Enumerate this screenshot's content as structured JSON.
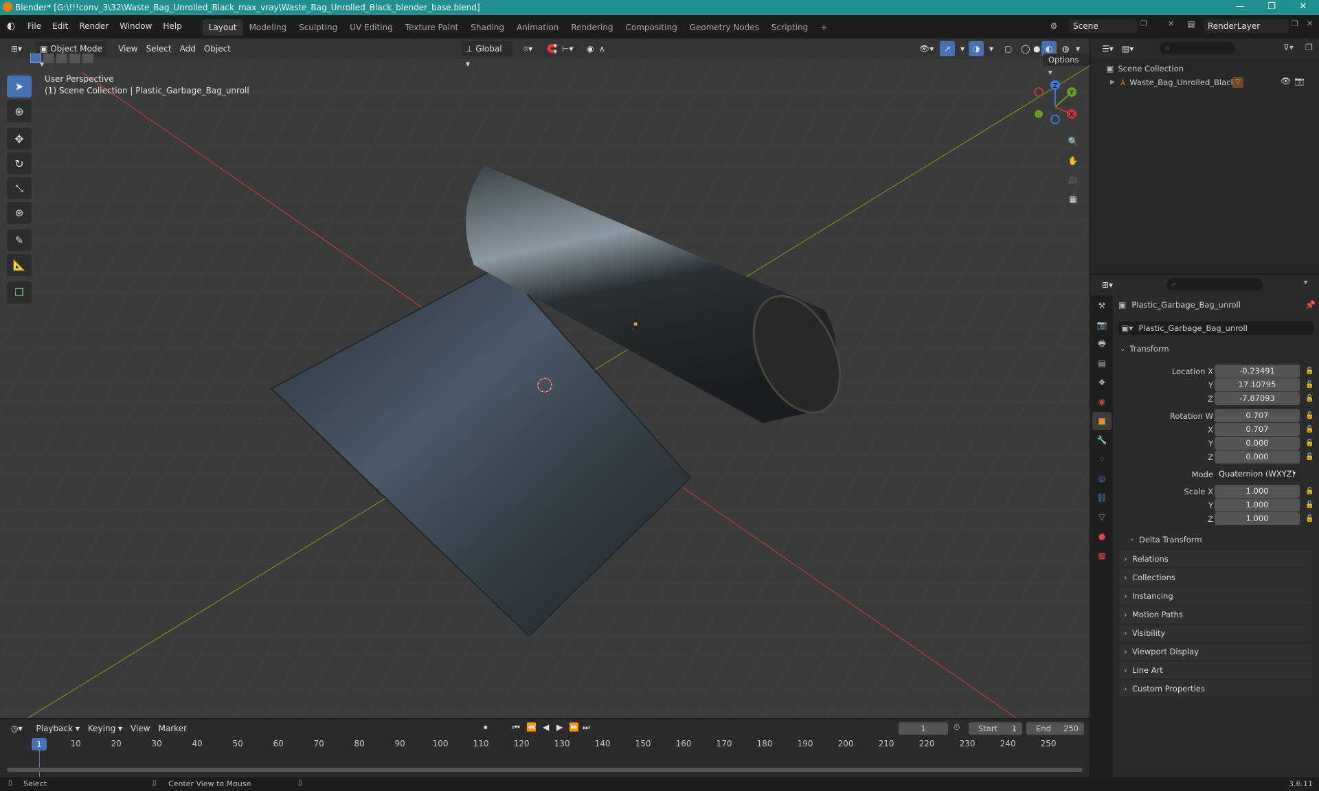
{
  "window": {
    "title": "Blender* [G:\\!!!conv_3\\32\\Waste_Bag_Unrolled_Black_max_vray\\Waste_Bag_Unrolled_Black_blender_base.blend]",
    "minimize": "—",
    "restore": "❐",
    "close": "✕"
  },
  "menus": [
    "File",
    "Edit",
    "Render",
    "Window",
    "Help"
  ],
  "workspaces": [
    "Layout",
    "Modeling",
    "Sculpting",
    "UV Editing",
    "Texture Paint",
    "Shading",
    "Animation",
    "Rendering",
    "Compositing",
    "Geometry Nodes",
    "Scripting"
  ],
  "active_workspace": "Layout",
  "add_workspace": "+",
  "scene": {
    "name": "Scene",
    "render_layer": "RenderLayer"
  },
  "viewport": {
    "mode": "Object Mode",
    "menus": [
      "View",
      "Select",
      "Add",
      "Object"
    ],
    "orientation": "Global",
    "options": "Options",
    "overlay_title": "User Perspective",
    "overlay_subtitle": "(1) Scene Collection | Plastic_Garbage_Bag_unroll",
    "gizmo": {
      "z": "Z",
      "y": "Y",
      "x": "X"
    }
  },
  "outliner": {
    "root": "Scene Collection",
    "items": [
      {
        "name": "Waste_Bag_Unrolled_Black"
      }
    ]
  },
  "properties": {
    "object_name": "Plastic_Garbage_Bag_unroll",
    "object_field": "Plastic_Garbage_Bag_unroll",
    "transform_label": "Transform",
    "location": {
      "label_x": "Location X",
      "label_y": "Y",
      "label_z": "Z",
      "x": "-0.23491",
      "y": "17.10795",
      "z": "-7.87093"
    },
    "rotation": {
      "label_w": "Rotation W",
      "label_x": "X",
      "label_y": "Y",
      "label_z": "Z",
      "w": "0.707",
      "x": "0.707",
      "y": "0.000",
      "z": "0.000"
    },
    "mode": {
      "label": "Mode",
      "value": "Quaternion (WXYZ)"
    },
    "scale": {
      "label_x": "Scale X",
      "label_y": "Y",
      "label_z": "Z",
      "x": "1.000",
      "y": "1.000",
      "z": "1.000"
    },
    "delta_transform": "Delta Transform",
    "panels": [
      "Relations",
      "Collections",
      "Instancing",
      "Motion Paths",
      "Visibility",
      "Viewport Display",
      "Line Art",
      "Custom Properties"
    ]
  },
  "timeline": {
    "menus": [
      "Playback",
      "Keying",
      "View",
      "Marker"
    ],
    "current_frame": "1",
    "start_label": "Start",
    "start": "1",
    "end_label": "End",
    "end": "250",
    "ticks": [
      "10",
      "20",
      "30",
      "40",
      "50",
      "60",
      "70",
      "80",
      "90",
      "100",
      "110",
      "120",
      "130",
      "140",
      "150",
      "160",
      "170",
      "180",
      "190",
      "200",
      "210",
      "220",
      "230",
      "240",
      "250"
    ]
  },
  "status": {
    "select": "Select",
    "center": "Center View to Mouse",
    "version": "3.6.11"
  },
  "colors": {
    "accent": "#4772b3",
    "titlebar": "#1f8f8f",
    "x_axis": "#c0393b",
    "y_axis": "#6a9a1f",
    "z_axis": "#3b7bd6",
    "object_orange": "#f0a030"
  }
}
